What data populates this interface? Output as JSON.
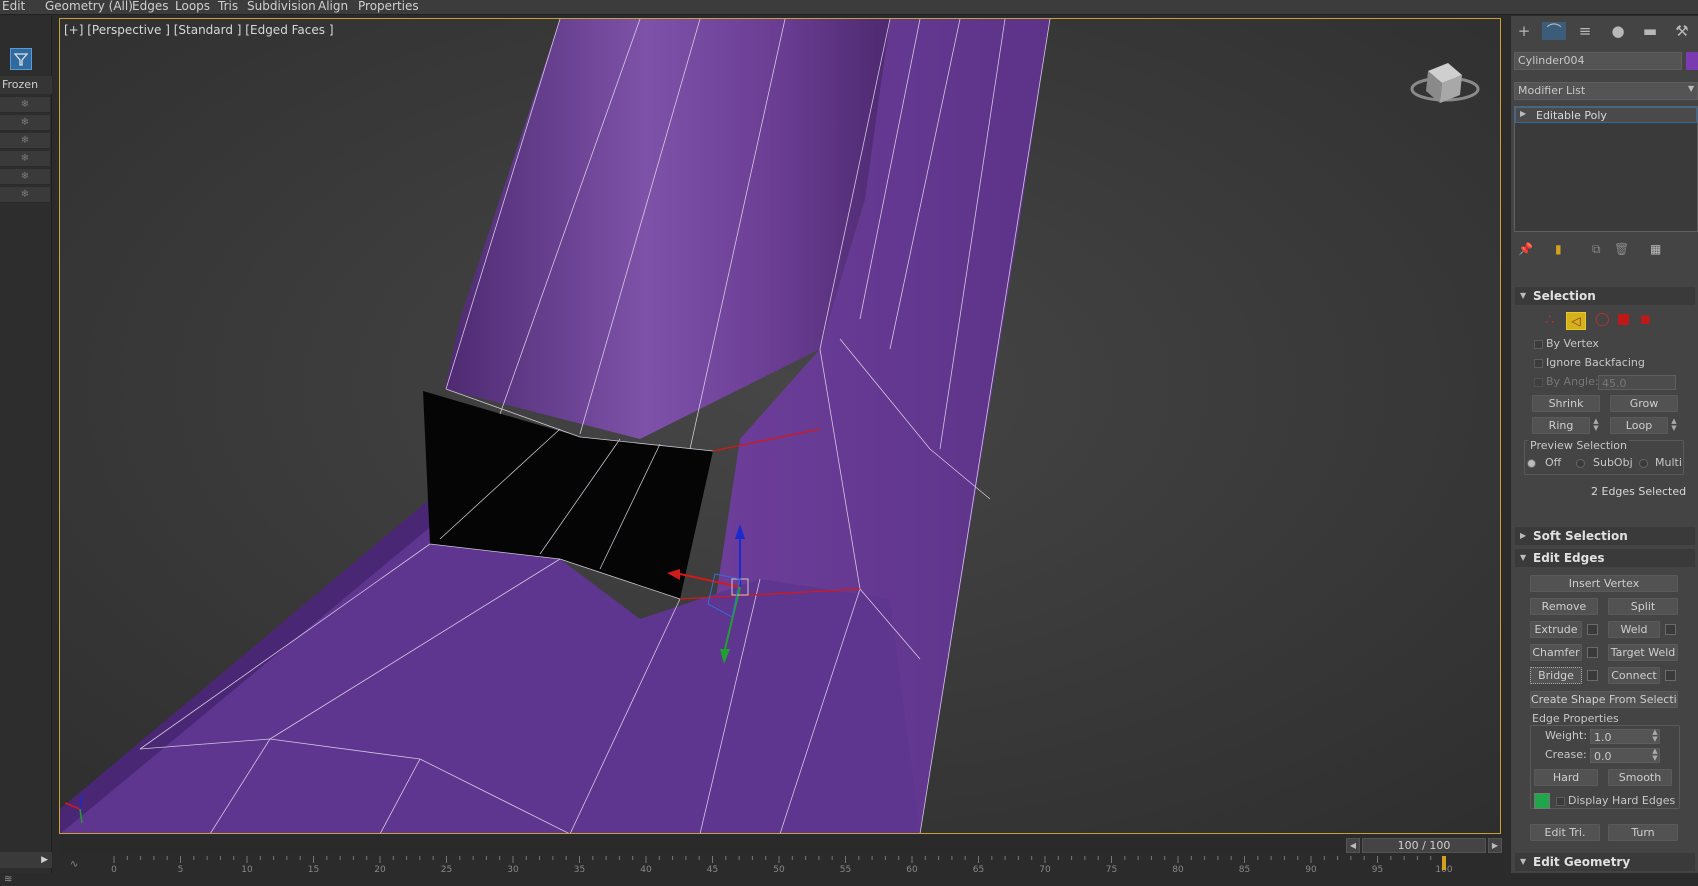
{
  "menubar": {
    "items": [
      "Edit",
      "Geometry (All)",
      "Edges",
      "Loops",
      "Tris",
      "Subdivision",
      "Align",
      "Properties"
    ]
  },
  "scene_panel": {
    "column_header": "Frozen",
    "rows": [
      "❄",
      "❄",
      "❄",
      "❄",
      "❄",
      "❄"
    ]
  },
  "viewport": {
    "label": "[+] [Perspective ] [Standard ] [Edged Faces ]",
    "object_color": "#6a3d93",
    "selection_color": "#d11a1a",
    "gizmo_axes": [
      "x",
      "y",
      "z"
    ]
  },
  "timeline": {
    "frame_counter": "100 / 100",
    "ruler_ticks": [
      "0",
      "5",
      "10",
      "15",
      "20",
      "25",
      "30",
      "35",
      "40",
      "45",
      "50",
      "55",
      "60",
      "65",
      "70",
      "75",
      "80",
      "85",
      "90",
      "95",
      "100"
    ]
  },
  "command_panel": {
    "tabs": [
      "create-icon",
      "modify-icon",
      "hierarchy-icon",
      "motion-icon",
      "display-icon",
      "utilities-icon"
    ],
    "object_name": "Cylinder004",
    "object_color": "#7a3ab0",
    "modifier_list": "Modifier List",
    "stack_item": "Editable Poly",
    "selection": {
      "title": "Selection",
      "by_vertex": "By Vertex",
      "ignore_backfacing": "Ignore Backfacing",
      "by_angle": "By Angle:",
      "by_angle_value": "45.0",
      "shrink": "Shrink",
      "grow": "Grow",
      "ring": "Ring",
      "loop": "Loop",
      "preview_selection": "Preview Selection",
      "preview_off": "Off",
      "preview_subobj": "SubObj",
      "preview_multi": "Multi",
      "status": "2 Edges Selected"
    },
    "soft_selection": {
      "title": "Soft Selection"
    },
    "edit_edges": {
      "title": "Edit Edges",
      "insert_vertex": "Insert Vertex",
      "remove": "Remove",
      "split": "Split",
      "extrude": "Extrude",
      "weld": "Weld",
      "chamfer": "Chamfer",
      "target_weld": "Target Weld",
      "bridge": "Bridge",
      "connect": "Connect",
      "create_shape": "Create Shape From Selection",
      "edge_properties": "Edge Properties",
      "weight_label": "Weight:",
      "weight_value": "1.0",
      "crease_label": "Crease:",
      "crease_value": "0.0",
      "hard": "Hard",
      "smooth": "Smooth",
      "display_hard_edges": "Display Hard Edges",
      "hard_edge_color": "#1fa64a",
      "edit_tri": "Edit Tri.",
      "turn": "Turn"
    },
    "edit_geometry": {
      "title": "Edit Geometry"
    }
  }
}
